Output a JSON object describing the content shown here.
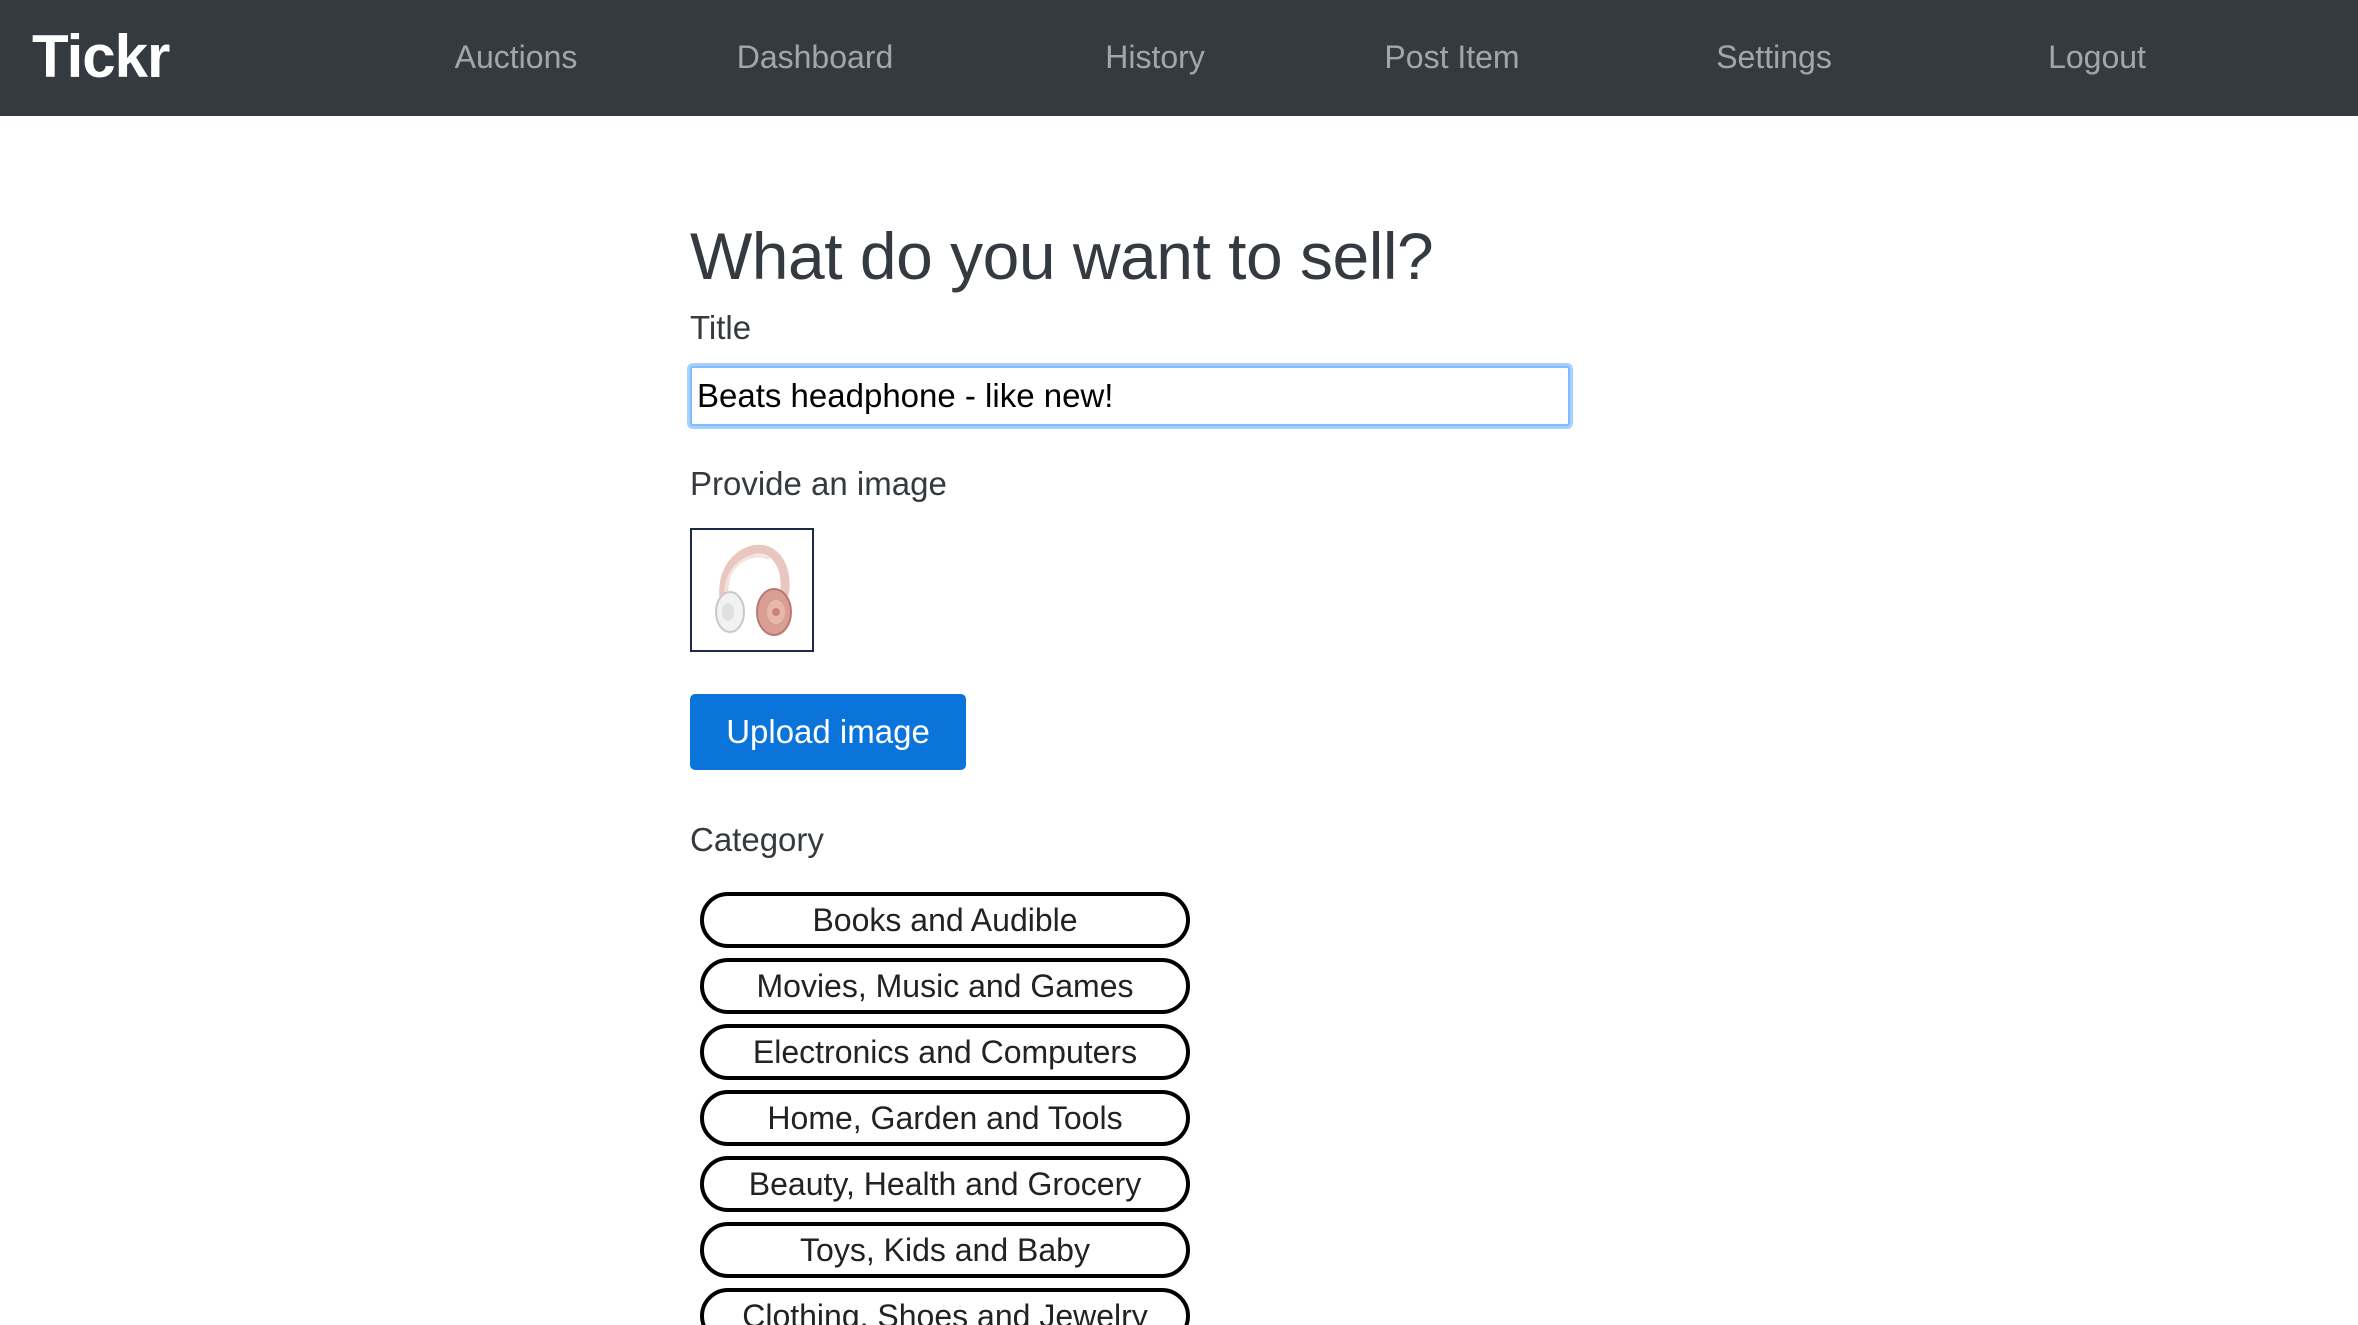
{
  "app": {
    "brand": "Tickr"
  },
  "nav": {
    "items": [
      {
        "label": "Auctions"
      },
      {
        "label": "Dashboard"
      },
      {
        "label": "History"
      },
      {
        "label": "Post Item"
      },
      {
        "label": "Settings"
      },
      {
        "label": "Logout"
      }
    ]
  },
  "form": {
    "heading": "What do you want to sell?",
    "title_label": "Title",
    "title_value": "Beats headphone - like new!",
    "image_label": "Provide an image",
    "upload_button": "Upload image",
    "category_label": "Category",
    "categories": [
      {
        "label": "Books and Audible"
      },
      {
        "label": "Movies, Music and Games"
      },
      {
        "label": "Electronics and Computers"
      },
      {
        "label": "Home, Garden and Tools"
      },
      {
        "label": "Beauty, Health and Grocery"
      },
      {
        "label": "Toys, Kids and Baby"
      },
      {
        "label": "Clothing, Shoes and Jewelry"
      }
    ]
  },
  "colors": {
    "navbar": "#343a40",
    "primary_button": "#0a74da",
    "focus_ring": "#80bdff"
  }
}
